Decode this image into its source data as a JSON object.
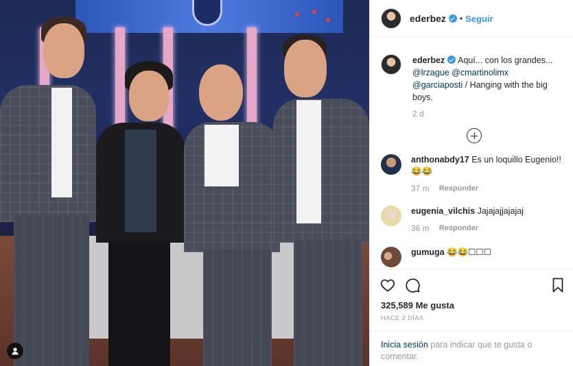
{
  "post": {
    "author": {
      "username": "ederbez",
      "verified": true,
      "separator": "•",
      "follow_label": "Seguir"
    },
    "caption": {
      "username": "ederbez",
      "text_1": "Aquí... con los grandes...",
      "mention_1": "@lrzague",
      "mention_2": "@cmartinolimx",
      "mention_3": "@garciaposti",
      "text_2": "/ Hanging with the big boys.",
      "time": "2 d"
    },
    "comments": [
      {
        "username": "anthonabdy17",
        "text": "Es un loquillo Eugenio!!😂😂",
        "time": "37 m",
        "reply_label": "Responder"
      },
      {
        "username": "eugenia_vilchis",
        "text": "Jajajajjajajaj",
        "time": "36 m",
        "reply_label": "Responder"
      },
      {
        "username": "gumuga",
        "text": "😂😂☐☐☐"
      }
    ],
    "likes": "325,589 Me gusta",
    "posted_ago": "HACE 2 DÍAS",
    "login_prompt": {
      "link": "Inicia sesión",
      "text": "para indicar que te gusta o comentar."
    }
  },
  "colors": {
    "accent": "#3897f0",
    "link": "#003569",
    "muted": "#999999",
    "text": "#262626"
  },
  "icons": [
    "user-tag-icon",
    "heart-icon",
    "comment-icon",
    "bookmark-icon",
    "add-comments-icon",
    "verified-icon"
  ]
}
